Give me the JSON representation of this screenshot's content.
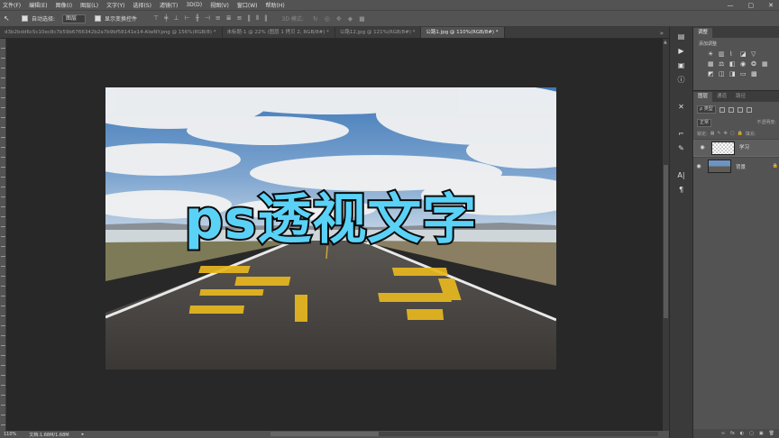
{
  "menu": [
    "文件(F)",
    "编辑(E)",
    "图像(I)",
    "图层(L)",
    "文字(Y)",
    "选择(S)",
    "滤镜(T)",
    "3D(D)",
    "视图(V)",
    "窗口(W)",
    "帮助(H)"
  ],
  "window_controls": {
    "minimize": "—",
    "restore": "▢",
    "close": "✕"
  },
  "options": {
    "tool_icon": "↖",
    "auto_select_label": "自动选择:",
    "auto_select_value": "图层",
    "show_transform_label": "显示变换控件",
    "mode_3d_label": "3D 模式:"
  },
  "tabs": [
    {
      "label": "d3b2bdd6c5c10ec8c7b59b6766342b2a7b9bf58141e14-AlwNY.png @ 156%(RGB/8) *",
      "active": false
    },
    {
      "label": "未标题-1 @ 22% (图层 1 拷贝 2, RGB/8#) *",
      "active": false
    },
    {
      "label": "公路12.jpg @ 121%(RGB/8#) *",
      "active": false
    },
    {
      "label": "公路1.jpg @ 110%(RGB/8#) *",
      "active": true
    }
  ],
  "canvas": {
    "headline": "ps透视文字",
    "road_text": "学习"
  },
  "status": {
    "zoom": "110%",
    "doc": "文档:1.68M/1.68M"
  },
  "right_panel": {
    "top_tab": "调整",
    "adjust_title": "添加调整",
    "layer_tabs": [
      "图层",
      "通道",
      "路径"
    ],
    "kind_filter": "ρ 类型",
    "blend_mode": "正常",
    "opacity": "不透明度:",
    "lock_label": "锁定:",
    "fill_label": "填充:",
    "layers": [
      {
        "name": "学习",
        "selected": true,
        "type": "transparent"
      },
      {
        "name": "背景",
        "selected": false,
        "type": "photo"
      }
    ],
    "footer_icons": [
      "∞",
      "fx",
      "◐",
      "▢",
      "▣",
      "🗑"
    ]
  },
  "colors": {
    "headline": "#5ad2f7",
    "road_paint": "#e8b820",
    "asphalt": "#3e3b39",
    "sky": "#4f86c0"
  }
}
